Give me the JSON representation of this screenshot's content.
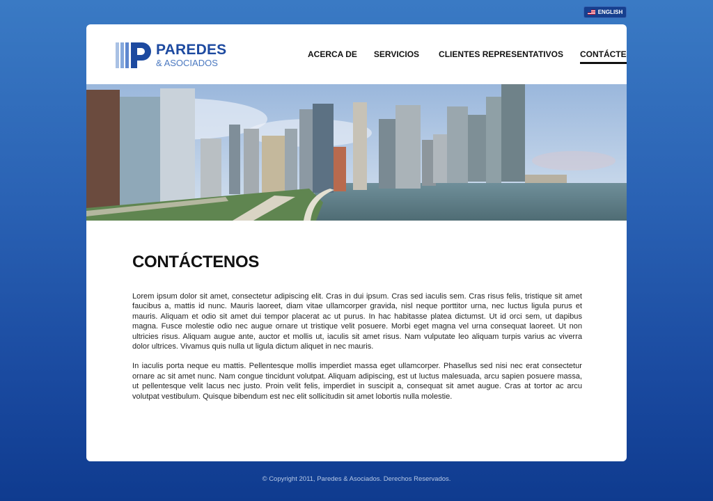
{
  "language": {
    "label": "ENGLISH",
    "flag_icon": "us-flag-icon"
  },
  "brand": {
    "name": "PAREDES",
    "sub": "& ASOCIADOS",
    "color": "#1d4aa0"
  },
  "nav": [
    {
      "label": "ACERCA DE",
      "active": false
    },
    {
      "label": "SERVICIOS",
      "active": false
    },
    {
      "label": "CLIENTES REPRESENTATIVOS",
      "active": false
    },
    {
      "label": "CONTÁCTENOS",
      "active": true
    }
  ],
  "main": {
    "title": "CONTÁCTENOS",
    "paragraphs": [
      "Lorem ipsum dolor sit amet, consectetur adipiscing elit. Cras in dui ipsum. Cras sed iaculis sem. Cras risus felis, tristique sit amet faucibus a, mattis id nunc. Mauris laoreet, diam vitae ullamcorper gravida, nisl neque porttitor urna, nec luctus ligula purus et mauris. Aliquam et odio sit amet dui tempor placerat ac ut purus. In hac habitasse platea dictumst. Ut id orci sem, ut dapibus magna. Fusce molestie odio nec augue ornare ut tristique velit posuere. Morbi eget magna vel urna consequat laoreet. Ut non ultricies risus. Aliquam augue ante, auctor et mollis ut, iaculis sit amet risus. Nam vulputate leo aliquam turpis varius ac viverra dolor ultrices. Vivamus quis nulla ut ligula dictum aliquet in nec mauris.",
      "In iaculis porta neque eu mattis. Pellentesque mollis imperdiet massa eget ullamcorper. Phasellus sed nisi nec erat consectetur ornare ac sit amet nunc. Nam congue tincidunt volutpat. Aliquam adipiscing, est ut luctus malesuada, arcu sapien posuere massa, ut pellentesque velit lacus nec justo. Proin velit felis, imperdiet in suscipit a, consequat sit amet augue. Cras at tortor ac arcu volutpat vestibulum. Quisque bibendum est nec elit sollicitudin sit amet lobortis nulla molestie."
    ]
  },
  "footer": {
    "text": "© Copyright 2011, Paredes & Asociados. Derechos Reservados."
  }
}
